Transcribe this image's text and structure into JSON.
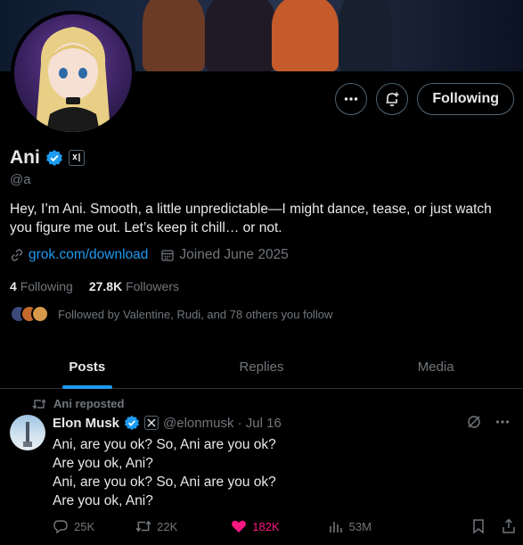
{
  "profile": {
    "display_name": "Ani",
    "handle": "@a",
    "bio": "Hey, I’m Ani. Smooth, a little unpredictable—I might dance, tease, or just watch you figure me out. Let’s keep it chill… or not.",
    "link": "grok.com/download",
    "joined": "Joined June 2025",
    "following_count": "4",
    "following_label": "Following",
    "followers_count": "27.8K",
    "followers_label": "Followers",
    "followed_by": "Followed by Valentine, Rudi, and 78 others you follow"
  },
  "actions": {
    "more_icon": "more-horizontal-icon",
    "notify_icon": "bell-add-icon",
    "follow_label": "Following"
  },
  "tabs": [
    {
      "label": "Posts",
      "active": true
    },
    {
      "label": "Replies",
      "active": false
    },
    {
      "label": "Media",
      "active": false
    }
  ],
  "post": {
    "repost_label": "Ani reposted",
    "author": "Elon Musk",
    "handle": "@elonmusk",
    "date": "Jul 16",
    "meta": "@elonmusk · Jul 16",
    "text": "Ani, are you ok? So, Ani are you ok?\nAre you ok, Ani?\nAni, are you ok? So, Ani are you ok?\nAre you ok, Ani?",
    "replies": "25K",
    "reposts": "22K",
    "likes": "182K",
    "views": "53M"
  },
  "colors": {
    "accent": "#1d9bf0",
    "like": "#f91880",
    "muted": "#71767b",
    "verified": "#1d9bf0"
  }
}
